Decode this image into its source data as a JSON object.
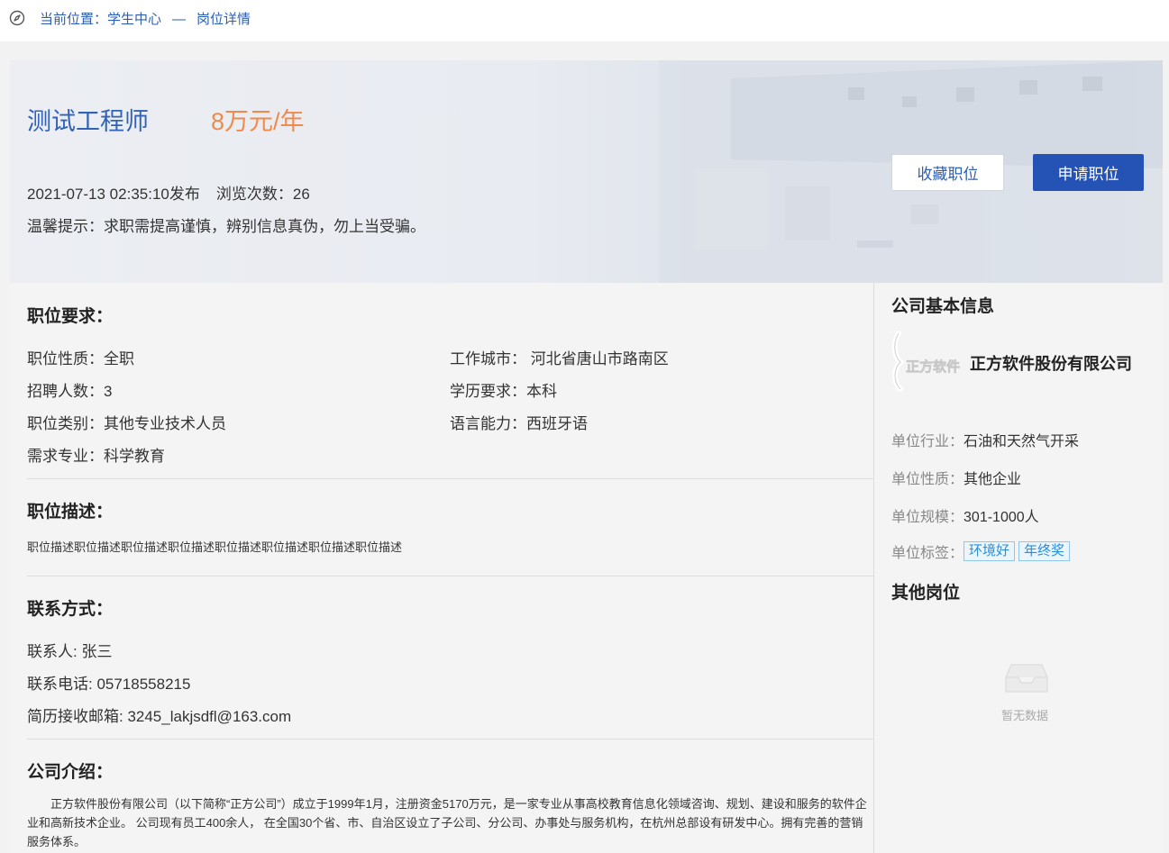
{
  "breadcrumb": {
    "prefix": "当前位置：学生中心",
    "separator": "—",
    "current": "岗位详情"
  },
  "job": {
    "title": "测试工程师",
    "salary": "8万元/年",
    "published": "2021-07-13 02:35:10发布",
    "views": "浏览次数：26",
    "tip": "温馨提示：求职需提高谨慎，辨别信息真伪，勿上当受骗。"
  },
  "buttons": {
    "favorite": "收藏职位",
    "apply": "申请职位"
  },
  "requirements": {
    "heading": "职位要求：",
    "nature": "职位性质：全职",
    "city": "工作城市： 河北省唐山市路南区",
    "count": "招聘人数：3",
    "education": "学历要求：本科",
    "category": "职位类别：其他专业技术人员",
    "language": "语言能力：西班牙语",
    "major": "需求专业：科学教育"
  },
  "description": {
    "heading": "职位描述：",
    "text": "职位描述职位描述职位描述职位描述职位描述职位描述职位描述职位描述"
  },
  "contact": {
    "heading": "联系方式：",
    "person": "联系人: 张三",
    "phone": "联系电话: 05718558215",
    "email": "简历接收邮箱: 3245_lakjsdfl@163.com"
  },
  "intro": {
    "heading": "公司介绍：",
    "text": "正方软件股份有限公司（以下简称“正方公司”）成立于1999年1月，注册资金5170万元，是一家专业从事高校教育信息化领域咨询、规划、建设和服务的软件企业和高新技术企业。 公司现有员工400余人， 在全国30个省、市、自治区设立了子公司、分公司、办事处与服务机构，在杭州总部设有研发中心。拥有完善的营销服务体系。"
  },
  "company": {
    "heading": "公司基本信息",
    "logo_text": "正方软件",
    "name": "正方软件股份有限公司",
    "industry_label": "单位行业：",
    "industry": "石油和天然气开采",
    "nature_label": "单位性质：",
    "nature": "其他企业",
    "scale_label": "单位规模：",
    "scale": "301-1000人",
    "tags_label": "单位标签：",
    "tags": [
      "环境好",
      "年终奖"
    ]
  },
  "other_jobs": {
    "heading": "其他岗位",
    "empty": "暂无数据"
  },
  "colors": {
    "brand_blue": "#2452b5",
    "title_blue": "#3062b8",
    "salary_orange": "#f08a4b",
    "tag_blue": "#2a8ed8"
  }
}
